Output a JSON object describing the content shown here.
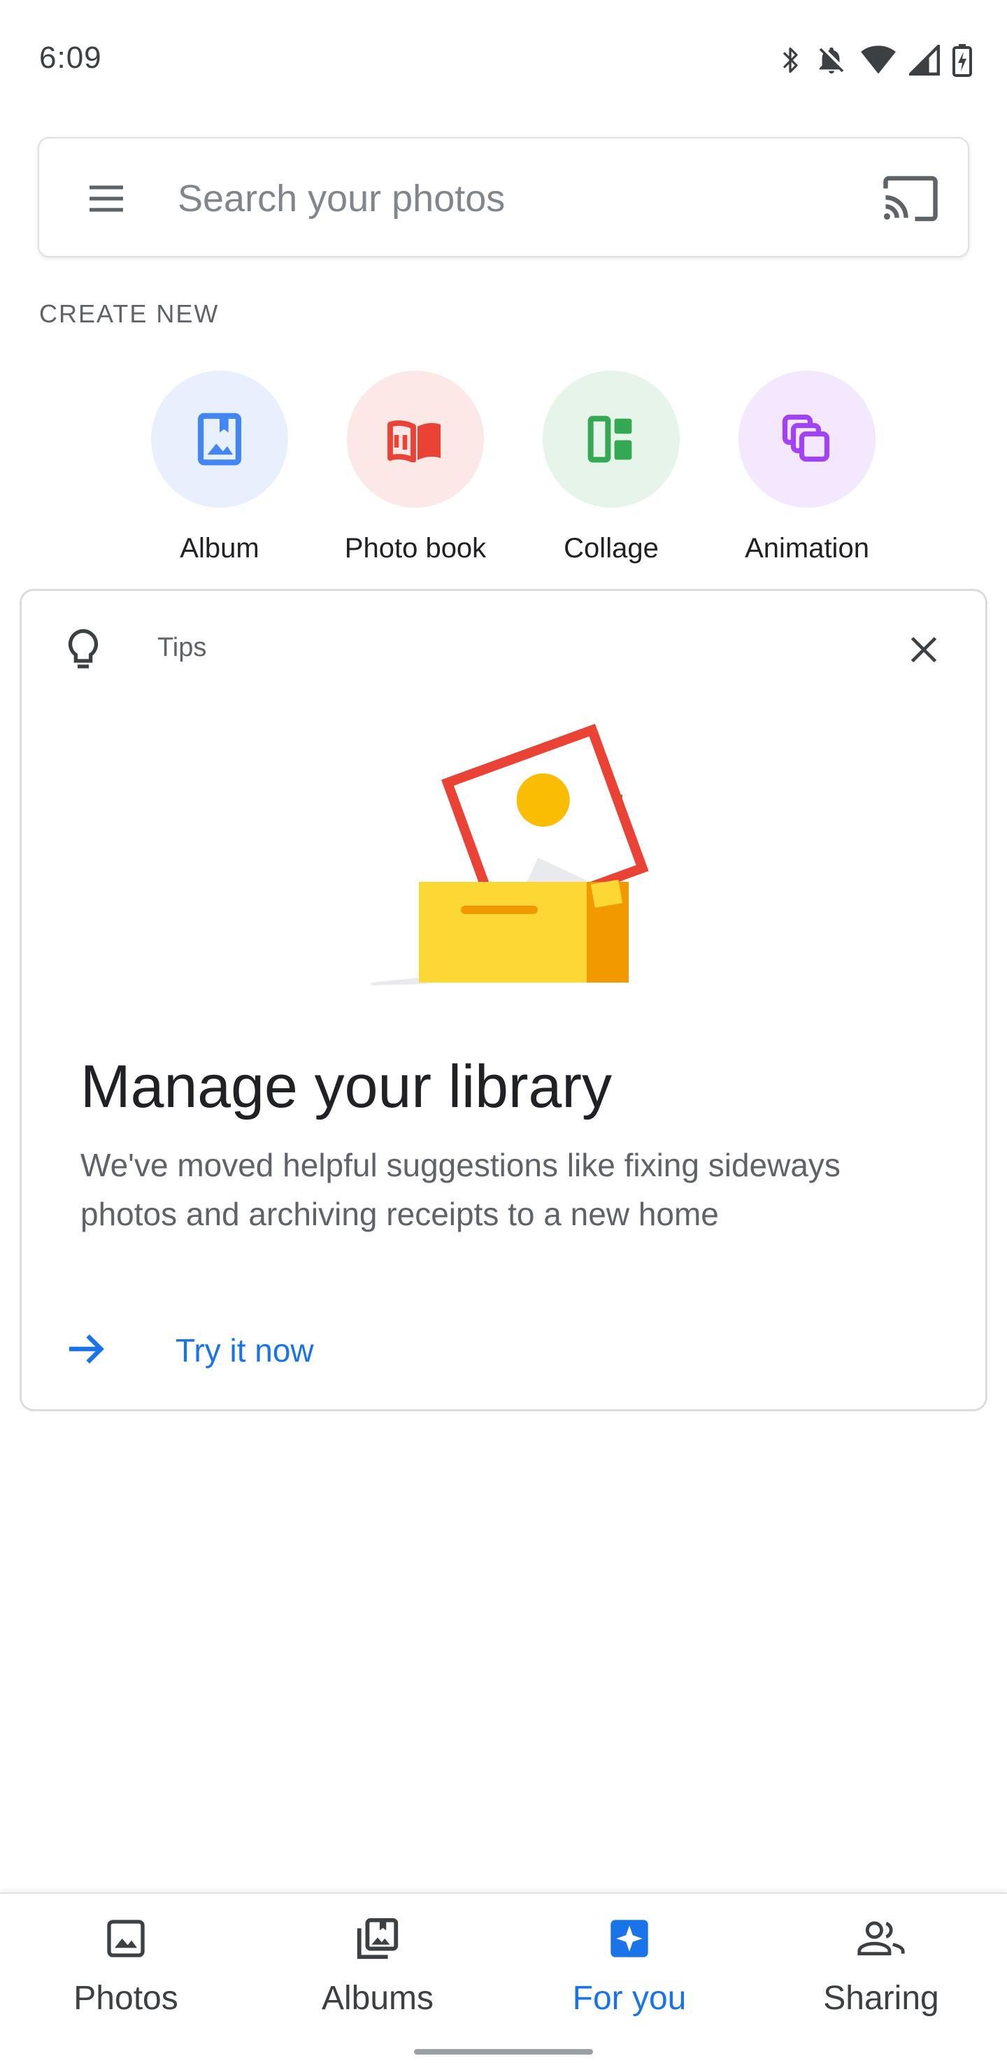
{
  "status_bar": {
    "time": "6:09",
    "icons": [
      "bluetooth-icon",
      "notifications-off-icon",
      "wifi-icon",
      "signal-icon",
      "battery-charging-icon"
    ]
  },
  "search": {
    "placeholder": "Search your photos",
    "value": ""
  },
  "create_new": {
    "label": "CREATE NEW",
    "items": [
      {
        "label": "Album",
        "icon": "album-icon",
        "bg": "#e8f0fe",
        "color": "#4285f4"
      },
      {
        "label": "Photo book",
        "icon": "photo-book-icon",
        "bg": "#fce8e6",
        "color": "#ea4335"
      },
      {
        "label": "Collage",
        "icon": "collage-icon",
        "bg": "#e6f4ea",
        "color": "#34a853"
      },
      {
        "label": "Animation",
        "icon": "animation-icon",
        "bg": "#f3e8fd",
        "color": "#a142f4"
      }
    ]
  },
  "tips": {
    "label": "Tips",
    "title": "Manage your library",
    "body": "We've moved helpful suggestions like fixing sideways photos and archiving receipts to a new home",
    "action": "Try it now"
  },
  "bottom_nav": {
    "items": [
      {
        "label": "Photos",
        "icon": "photos-icon",
        "active": false
      },
      {
        "label": "Albums",
        "icon": "albums-icon",
        "active": false
      },
      {
        "label": "For you",
        "icon": "for-you-icon",
        "active": true
      },
      {
        "label": "Sharing",
        "icon": "sharing-icon",
        "active": false
      }
    ]
  },
  "colors": {
    "accent": "#1a73e8",
    "text_primary": "#202124",
    "text_secondary": "#5f6368"
  }
}
